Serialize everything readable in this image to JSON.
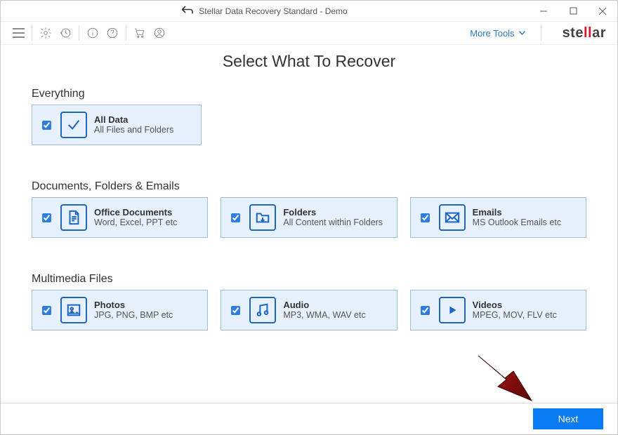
{
  "window": {
    "title": "Stellar Data Recovery Standard - Demo"
  },
  "toolbar": {
    "more_tools": "More Tools",
    "brand_pre": "ste",
    "brand_hi": "ll",
    "brand_post": "ar"
  },
  "page": {
    "title": "Select What To Recover"
  },
  "sections": {
    "everything": {
      "heading": "Everything",
      "card": {
        "title": "All Data",
        "subtitle": "All Files and Folders"
      }
    },
    "documents": {
      "heading": "Documents, Folders & Emails",
      "cards": [
        {
          "title": "Office Documents",
          "subtitle": "Word, Excel, PPT etc"
        },
        {
          "title": "Folders",
          "subtitle": "All Content within Folders"
        },
        {
          "title": "Emails",
          "subtitle": "MS Outlook Emails etc"
        }
      ]
    },
    "multimedia": {
      "heading": "Multimedia Files",
      "cards": [
        {
          "title": "Photos",
          "subtitle": "JPG, PNG, BMP etc"
        },
        {
          "title": "Audio",
          "subtitle": "MP3, WMA, WAV etc"
        },
        {
          "title": "Videos",
          "subtitle": "MPEG, MOV, FLV etc"
        }
      ]
    }
  },
  "footer": {
    "next": "Next"
  }
}
